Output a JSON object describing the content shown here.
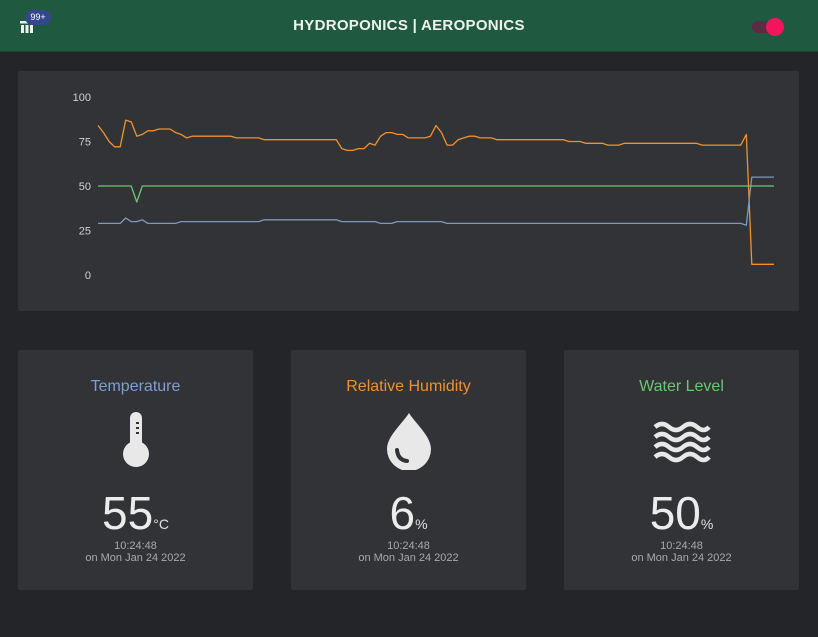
{
  "header": {
    "title": "HYDROPONICS | AEROPONICS",
    "notification_badge": "99+",
    "theme_toggle_on": true,
    "colors": {
      "background": "#1f5a40",
      "toggle_knob": "#f2155e",
      "toggle_track": "#5e2a44",
      "badge": "#34468c"
    }
  },
  "chart": {
    "y_ticks": [
      "100",
      "75",
      "50",
      "25",
      "0"
    ]
  },
  "chart_data": {
    "type": "line",
    "ylim": [
      0,
      100
    ],
    "grid": false,
    "legend": "none",
    "y_ticks": [
      0,
      25,
      50,
      75,
      100
    ],
    "series": [
      {
        "color": "#f0922c",
        "values": [
          84,
          80,
          75,
          72,
          72,
          87,
          86,
          78,
          79,
          81,
          81,
          82,
          82,
          82,
          80,
          79,
          77,
          78,
          78,
          78,
          78,
          78,
          78,
          78,
          78,
          77,
          77,
          77,
          77,
          77,
          76,
          76,
          76,
          76,
          76,
          76,
          76,
          76,
          76,
          76,
          76,
          76,
          76,
          76,
          71,
          70,
          70,
          71,
          71,
          74,
          73,
          78,
          80,
          80,
          79,
          79,
          77,
          77,
          77,
          77,
          78,
          84,
          80,
          73,
          73,
          76,
          77,
          78,
          78,
          77,
          77,
          77,
          76,
          76,
          76,
          76,
          76,
          76,
          76,
          76,
          76,
          76,
          76,
          76,
          76,
          75,
          75,
          75,
          74,
          74,
          74,
          74,
          73,
          73,
          73,
          74,
          74,
          74,
          74,
          74,
          74,
          74,
          74,
          74,
          74,
          74,
          74,
          74,
          74,
          73,
          73,
          73,
          73,
          73,
          73,
          73,
          73,
          79,
          6,
          6,
          6,
          6,
          6
        ]
      },
      {
        "color": "#7e98be",
        "values": [
          29,
          29,
          29,
          29,
          29,
          32,
          30,
          30,
          31,
          29,
          29,
          29,
          29,
          29,
          29,
          30,
          30,
          30,
          30,
          30,
          30,
          30,
          30,
          30,
          30,
          30,
          30,
          30,
          30,
          30,
          31,
          31,
          31,
          31,
          31,
          31,
          31,
          31,
          31,
          31,
          31,
          31,
          31,
          31,
          30,
          30,
          30,
          30,
          30,
          30,
          30,
          29,
          29,
          29,
          30,
          30,
          30,
          30,
          30,
          30,
          30,
          30,
          30,
          29,
          29,
          29,
          29,
          29,
          29,
          29,
          29,
          29,
          29,
          29,
          29,
          29,
          29,
          29,
          29,
          29,
          29,
          29,
          29,
          29,
          29,
          29,
          29,
          29,
          29,
          29,
          29,
          29,
          29,
          29,
          29,
          29,
          29,
          29,
          29,
          29,
          29,
          29,
          29,
          29,
          29,
          29,
          29,
          29,
          29,
          29,
          29,
          29,
          29,
          29,
          29,
          29,
          29,
          28,
          55,
          55,
          55,
          55,
          55
        ]
      },
      {
        "color": "#6ec472",
        "values": [
          50,
          50,
          50,
          50,
          50,
          50,
          50,
          41,
          50,
          50,
          50,
          50,
          50,
          50,
          50,
          50,
          50,
          50,
          50,
          50,
          50,
          50,
          50,
          50,
          50,
          50,
          50,
          50,
          50,
          50,
          50,
          50,
          50,
          50,
          50,
          50,
          50,
          50,
          50,
          50,
          50,
          50,
          50,
          50,
          50,
          50,
          50,
          50,
          50,
          50,
          50,
          50,
          50,
          50,
          50,
          50,
          50,
          50,
          50,
          50,
          50,
          50,
          50,
          50,
          50,
          50,
          50,
          50,
          50,
          50,
          50,
          50,
          50,
          50,
          50,
          50,
          50,
          50,
          50,
          50,
          50,
          50,
          50,
          50,
          50,
          50,
          50,
          50,
          50,
          50,
          50,
          50,
          50,
          50,
          50,
          50,
          50,
          50,
          50,
          50,
          50,
          50,
          50,
          50,
          50,
          50,
          50,
          50,
          50,
          50,
          50,
          50,
          50,
          50,
          50,
          50,
          50,
          50,
          50,
          50,
          50,
          50,
          50
        ]
      }
    ]
  },
  "sensors": [
    {
      "title": "Temperature",
      "value": "55",
      "unit": "°C",
      "time": "10:24:48",
      "date": "on Mon Jan 24 2022",
      "color": "#7c9fd4",
      "icon": "thermometer-icon"
    },
    {
      "title": "Relative Humidity",
      "value": "6",
      "unit": "%",
      "time": "10:24:48",
      "date": "on Mon Jan 24 2022",
      "color": "#f0922c",
      "icon": "water-drop-icon"
    },
    {
      "title": "Water Level",
      "value": "50",
      "unit": "%",
      "time": "10:24:48",
      "date": "on Mon Jan 24 2022",
      "color": "#6ec472",
      "icon": "waves-icon"
    }
  ]
}
